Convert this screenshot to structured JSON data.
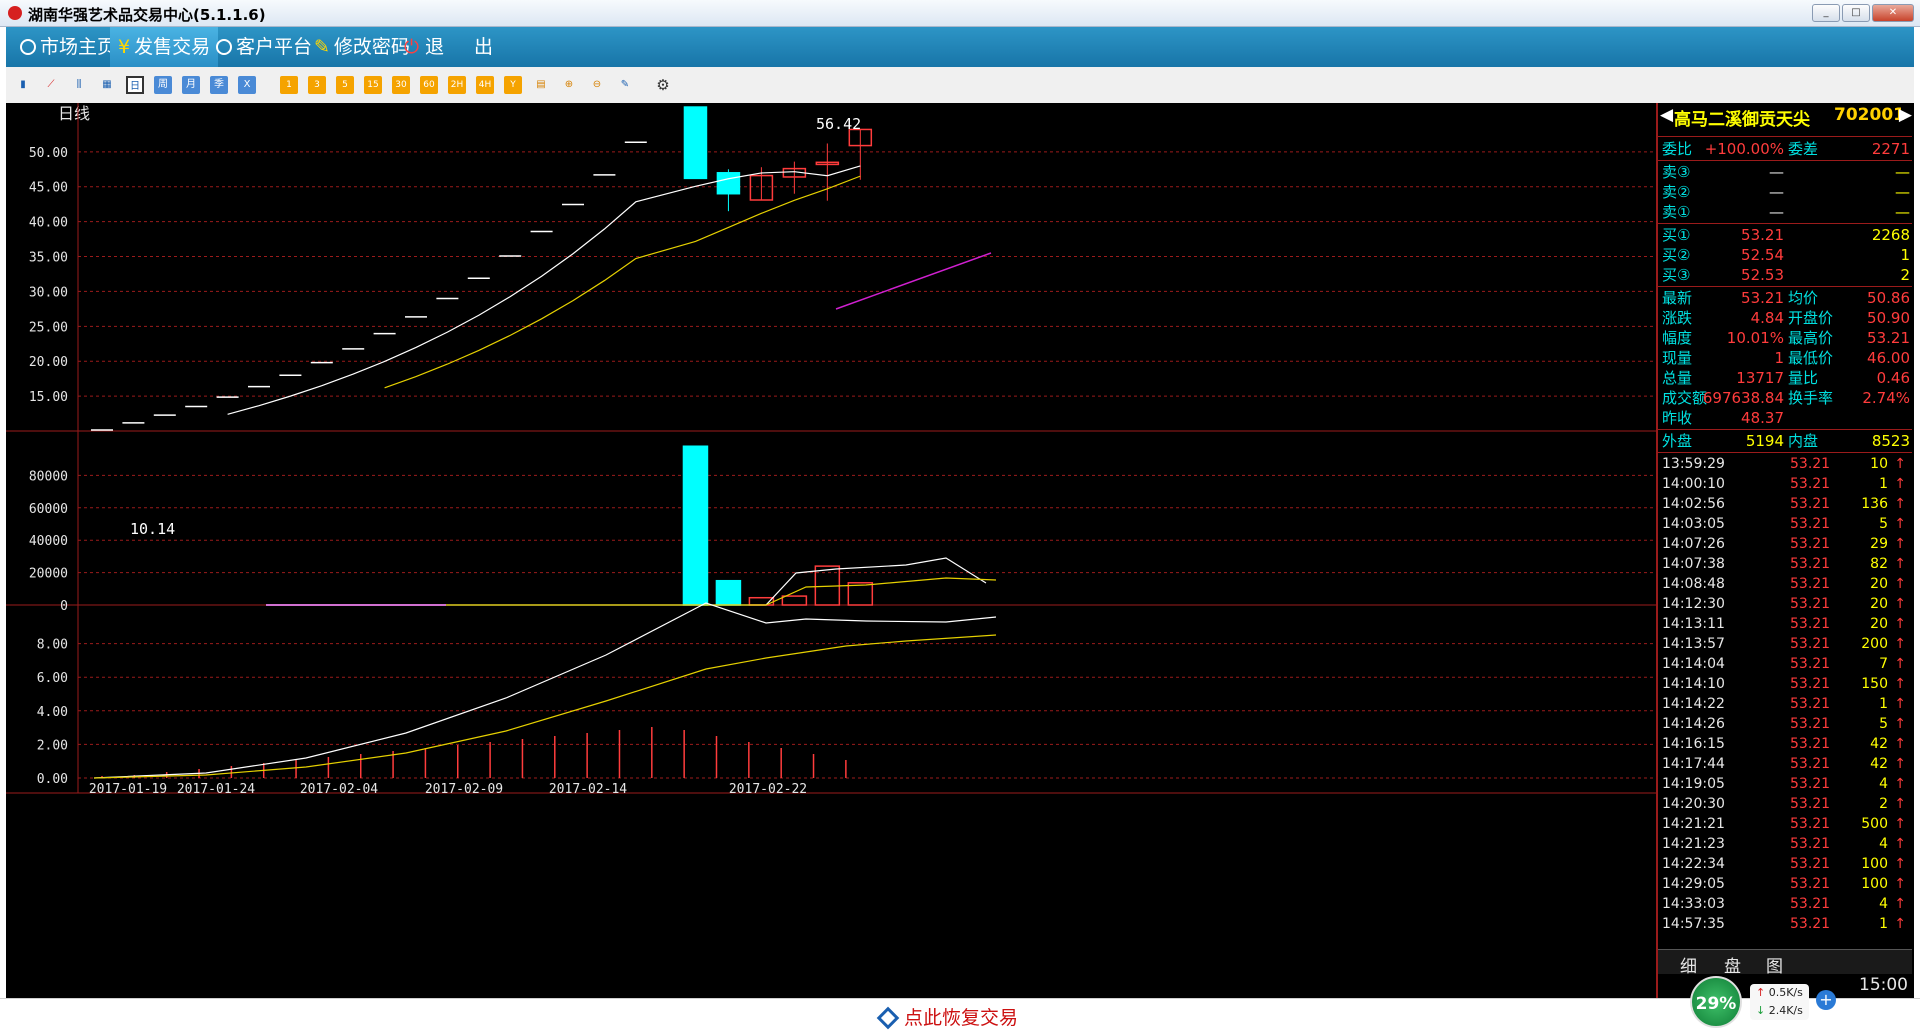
{
  "window": {
    "title": "湖南华强艺术品交易中心(5.1.1.6)"
  },
  "menu": [
    "市场主页",
    "发售交易",
    "客户平台",
    "修改密码",
    "退",
    "出"
  ],
  "toolbar": {
    "buttons": [
      "日",
      "周",
      "月",
      "季",
      "X",
      "1",
      "3",
      "5",
      "15",
      "30",
      "60",
      "2H",
      "4H",
      "Y"
    ]
  },
  "chart": {
    "period_label": "日线",
    "high_label": "56.42",
    "low_label": "10.14",
    "price_ticks": [
      "50.00",
      "45.00",
      "40.00",
      "35.00",
      "30.00",
      "25.00",
      "20.00",
      "15.00"
    ],
    "volume_ticks": [
      "80000",
      "60000",
      "40000",
      "20000",
      "0"
    ],
    "indicator_ticks": [
      "8.00",
      "6.00",
      "4.00",
      "2.00",
      "0.00"
    ],
    "dates": [
      "2017-01-19",
      "2017-01-24",
      "2017-02-04",
      "2017-02-09",
      "2017-02-14",
      "2017-02-22"
    ]
  },
  "chart_data": {
    "type": "candlestick",
    "price_axis": {
      "ylim": [
        10,
        57
      ]
    },
    "limit_up_bars": [
      10.14,
      11.16,
      12.28,
      13.51,
      14.86,
      16.35,
      17.99,
      19.79,
      21.77,
      23.95,
      26.35,
      28.99,
      31.89,
      35.08,
      38.59,
      42.45,
      46.7,
      51.37
    ],
    "candles": [
      {
        "open": 56.42,
        "close": 46.2,
        "high": 56.42,
        "low": 46.2
      },
      {
        "open": 47.0,
        "close": 44.0,
        "high": 47.5,
        "low": 41.5
      },
      {
        "open": 43.1,
        "close": 46.6,
        "high": 47.8,
        "low": 43.1
      },
      {
        "open": 46.4,
        "close": 47.6,
        "high": 48.6,
        "low": 44.0
      },
      {
        "open": 48.2,
        "close": 48.5,
        "high": 51.2,
        "low": 43.0
      },
      {
        "open": 50.9,
        "close": 53.21,
        "high": 53.21,
        "low": 46.0
      }
    ],
    "volume": {
      "ylim": [
        0,
        100000
      ],
      "bars": [
        0,
        98000,
        15000,
        4500,
        5500,
        24000,
        13717
      ]
    },
    "indicator": {
      "ylim": [
        0,
        10
      ]
    }
  },
  "quote": {
    "name": "高马二溪御贡天尖",
    "code": "702001",
    "weibi_label": "委比",
    "weibi": "+100.00%",
    "weicha_label": "委差",
    "weicha": "2271",
    "sell": [
      {
        "label": "卖③",
        "price": "—",
        "vol": "—"
      },
      {
        "label": "卖②",
        "price": "—",
        "vol": "—"
      },
      {
        "label": "卖①",
        "price": "—",
        "vol": "—"
      }
    ],
    "buy": [
      {
        "label": "买①",
        "price": "53.21",
        "vol": "2268"
      },
      {
        "label": "买②",
        "price": "52.54",
        "vol": "1"
      },
      {
        "label": "买③",
        "price": "52.53",
        "vol": "2"
      }
    ],
    "stats": [
      {
        "l1": "最新",
        "v1": "53.21",
        "l2": "均价",
        "v2": "50.86"
      },
      {
        "l1": "涨跌",
        "v1": "4.84",
        "l2": "开盘价",
        "v2": "50.90"
      },
      {
        "l1": "幅度",
        "v1": "10.01%",
        "l2": "最高价",
        "v2": "53.21"
      },
      {
        "l1": "现量",
        "v1": "1",
        "l2": "最低价",
        "v2": "46.00"
      },
      {
        "l1": "总量",
        "v1": "13717",
        "l2": "量比",
        "v2": "0.46"
      },
      {
        "l1": "成交额",
        "v1": "697638.84",
        "l2": "换手率",
        "v2": "2.74%"
      },
      {
        "l1": "昨收",
        "v1": "48.37",
        "l2": "",
        "v2": ""
      }
    ],
    "waipan_label": "外盘",
    "waipan": "5194",
    "neipan_label": "内盘",
    "neipan": "8523",
    "ticks": [
      {
        "time": "13:59:29",
        "price": "53.21",
        "vol": "10"
      },
      {
        "time": "14:00:10",
        "price": "53.21",
        "vol": "1"
      },
      {
        "time": "14:02:56",
        "price": "53.21",
        "vol": "136"
      },
      {
        "time": "14:03:05",
        "price": "53.21",
        "vol": "5"
      },
      {
        "time": "14:07:26",
        "price": "53.21",
        "vol": "29"
      },
      {
        "time": "14:07:38",
        "price": "53.21",
        "vol": "82"
      },
      {
        "time": "14:08:48",
        "price": "53.21",
        "vol": "20"
      },
      {
        "time": "14:12:30",
        "price": "53.21",
        "vol": "20"
      },
      {
        "time": "14:13:11",
        "price": "53.21",
        "vol": "20"
      },
      {
        "time": "14:13:57",
        "price": "53.21",
        "vol": "200"
      },
      {
        "time": "14:14:04",
        "price": "53.21",
        "vol": "7"
      },
      {
        "time": "14:14:10",
        "price": "53.21",
        "vol": "150"
      },
      {
        "time": "14:14:22",
        "price": "53.21",
        "vol": "1"
      },
      {
        "time": "14:14:26",
        "price": "53.21",
        "vol": "5"
      },
      {
        "time": "14:16:15",
        "price": "53.21",
        "vol": "42"
      },
      {
        "time": "14:17:44",
        "price": "53.21",
        "vol": "42"
      },
      {
        "time": "14:19:05",
        "price": "53.21",
        "vol": "4"
      },
      {
        "time": "14:20:30",
        "price": "53.21",
        "vol": "2"
      },
      {
        "time": "14:21:21",
        "price": "53.21",
        "vol": "500"
      },
      {
        "time": "14:21:23",
        "price": "53.21",
        "vol": "4"
      },
      {
        "time": "14:22:34",
        "price": "53.21",
        "vol": "100"
      },
      {
        "time": "14:29:05",
        "price": "53.21",
        "vol": "100"
      },
      {
        "time": "14:33:03",
        "price": "53.21",
        "vol": "4"
      },
      {
        "time": "14:57:35",
        "price": "53.21",
        "vol": "1"
      }
    ],
    "tabs": [
      "细",
      "盘",
      "图"
    ],
    "clock": "15:00"
  },
  "status": {
    "restore": "点此恢复交易",
    "net_percent": "29%",
    "up_speed": "0.5K/s",
    "down_speed": "2.4K/s"
  }
}
